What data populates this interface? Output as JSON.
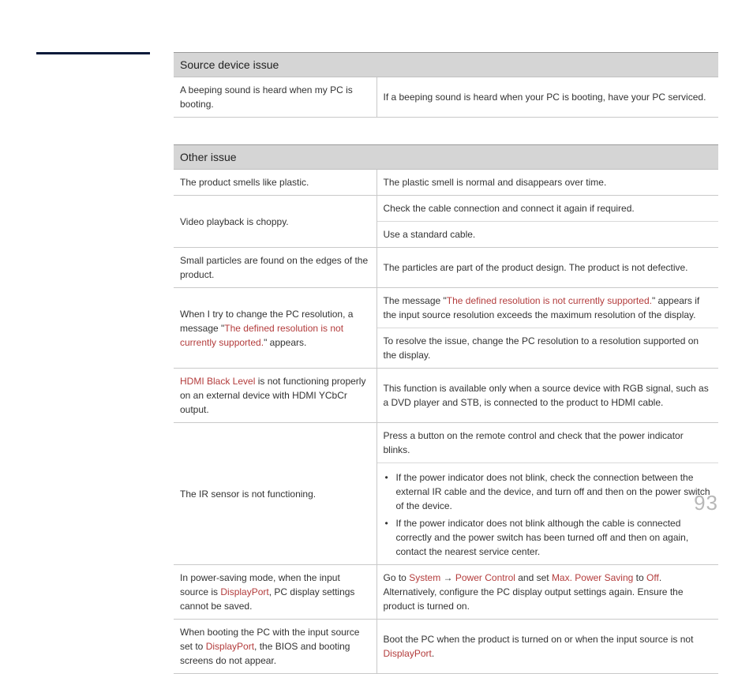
{
  "page_number": "93",
  "tables": [
    {
      "header": "Source device issue",
      "rows": [
        {
          "left": [
            {
              "text": "A beeping sound is heard when my PC is booting."
            }
          ],
          "right_cells": [
            {
              "parts": [
                {
                  "text": "If a beeping sound is heard when your PC is booting, have your PC serviced."
                }
              ]
            }
          ]
        }
      ]
    },
    {
      "header": "Other issue",
      "rows": [
        {
          "left": [
            {
              "text": "The product smells like plastic."
            }
          ],
          "right_cells": [
            {
              "parts": [
                {
                  "text": "The plastic smell is normal and disappears over time."
                }
              ]
            }
          ]
        },
        {
          "left": [
            {
              "text": "Video playback is choppy."
            }
          ],
          "right_cells": [
            {
              "parts": [
                {
                  "text": "Check the cable connection and connect it again if required."
                }
              ]
            },
            {
              "parts": [
                {
                  "text": "Use a standard cable."
                }
              ]
            }
          ]
        },
        {
          "left": [
            {
              "text": "Small particles are found on the edges of the product."
            }
          ],
          "right_cells": [
            {
              "parts": [
                {
                  "text": "The particles are part of the product design. The product is not defective."
                }
              ]
            }
          ]
        },
        {
          "left": [
            {
              "text": "When I try to change the PC resolution, a message \""
            },
            {
              "text": "The defined resolution is not currently supported.",
              "hl": true
            },
            {
              "text": "\" appears."
            }
          ],
          "right_cells": [
            {
              "parts": [
                {
                  "text": "The message \""
                },
                {
                  "text": "The defined resolution is not currently supported.",
                  "hl": true
                },
                {
                  "text": "\" appears if the input source resolution exceeds the maximum resolution of the display."
                }
              ]
            },
            {
              "parts": [
                {
                  "text": "To resolve the issue, change the PC resolution to a resolution supported on the display."
                }
              ]
            }
          ]
        },
        {
          "left": [
            {
              "text": "HDMI Black Level",
              "hl": true
            },
            {
              "text": " is not functioning properly on an external device with HDMI YCbCr output."
            }
          ],
          "right_cells": [
            {
              "parts": [
                {
                  "text": "This function is available only when a source device with RGB signal, such as a DVD player and STB, is connected to the product to HDMI cable."
                }
              ]
            }
          ]
        },
        {
          "left": [
            {
              "text": "The IR sensor is not functioning."
            }
          ],
          "right_cells": [
            {
              "parts": [
                {
                  "text": "Press a button on the remote control and check that the power indicator blinks."
                }
              ]
            },
            {
              "bullets": [
                [
                  {
                    "text": "If the power indicator does not blink, check the connection between the external IR cable and the device, and turn off and then on the power switch of the device."
                  }
                ],
                [
                  {
                    "text": "If the power indicator does not blink although the cable is connected correctly and the power switch has been turned off and then on again, contact the nearest service center."
                  }
                ]
              ]
            }
          ]
        },
        {
          "left": [
            {
              "text": "In power-saving mode, when the input source is "
            },
            {
              "text": "DisplayPort",
              "hl": true
            },
            {
              "text": ", PC display settings cannot be saved."
            }
          ],
          "right_cells": [
            {
              "parts": [
                {
                  "text": "Go to "
                },
                {
                  "text": "System",
                  "hl": true
                },
                {
                  "text": " → "
                },
                {
                  "text": "Power Control",
                  "hl": true
                },
                {
                  "text": " and set "
                },
                {
                  "text": "Max. Power Saving",
                  "hl": true
                },
                {
                  "text": " to "
                },
                {
                  "text": "Off",
                  "hl": true
                },
                {
                  "text": ". Alternatively, configure the PC display output settings again. Ensure the product is turned on."
                }
              ]
            }
          ]
        },
        {
          "left": [
            {
              "text": "When booting the PC with the input source set to "
            },
            {
              "text": "DisplayPort",
              "hl": true
            },
            {
              "text": ", the BIOS and booting screens do not appear."
            }
          ],
          "right_cells": [
            {
              "parts": [
                {
                  "text": "Boot the PC when the product is turned on or when the input source is not "
                },
                {
                  "text": "DisplayPort",
                  "hl": true
                },
                {
                  "text": "."
                }
              ]
            }
          ]
        }
      ]
    }
  ]
}
